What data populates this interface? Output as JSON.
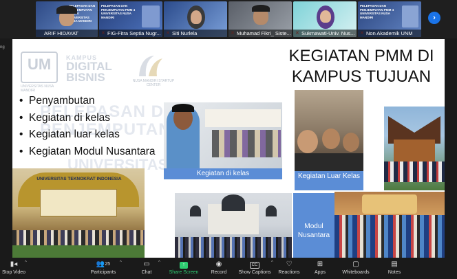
{
  "participants": [
    {
      "name": "ARIF HIDAYAT",
      "muted": false
    },
    {
      "name": "FIG-Fitra Septia Nugr...",
      "muted": true
    },
    {
      "name": "Siti Nurlela",
      "muted": true
    },
    {
      "name": "Muhamad Fikri_ Siste...",
      "muted": true
    },
    {
      "name": "Sukmawati-Univ. Nus...",
      "muted": true
    },
    {
      "name": "Non Akademik UNM",
      "muted": true
    }
  ],
  "thumb_slide_text": "PELEPASAN DAN PENJEMPUTAN PMM 4 UNIVERSITAS NUSA MANDIRI",
  "side_text": "ng",
  "next_icon": "chevron-right-icon",
  "slide": {
    "title": "KEGIATAN PMM DI KAMPUS TUJUAN",
    "logos": {
      "kdb_line1": "KAMPUS",
      "kdb_line2": "DIGITAL",
      "kdb_line3": "BISNIS",
      "unm_sub": "UNIVERSITAS NUSA MANDIRI",
      "nm_sub": "NUSA MANDIRI STARTUP CENTER"
    },
    "watermark": [
      "PELEPASAN DAN",
      "PENJEMPUTAN",
      "UNIVERSITAS"
    ],
    "bullets": [
      "Penyambutan",
      "Kegiatan di kelas",
      "Kegiatan luar kelas",
      "Kegiatan Modul Nusantara"
    ],
    "banner_text": "UNIVERSITAS TEKNOKRAT INDONESIA",
    "labels": {
      "kelas": "Kegiatan di kelas",
      "luar_kelas": "Kegiatan Luar Kelas",
      "modul": "Modul Nusantara"
    }
  },
  "toolbar": {
    "stop_video": "Stop Video",
    "participants": "Participants",
    "participants_count": "25",
    "chat": "Chat",
    "share_screen": "Share Screen",
    "record": "Record",
    "show_captions": "Show Captions",
    "cc": "CC",
    "reactions": "Reactions",
    "apps": "Apps",
    "whiteboards": "Whiteboards",
    "notes": "Notes"
  },
  "colors": {
    "accent_blue": "#1a73e8",
    "share_green": "#2ecc71",
    "label_blue": "#5b8dd6",
    "muted_red": "#e74c3c"
  }
}
